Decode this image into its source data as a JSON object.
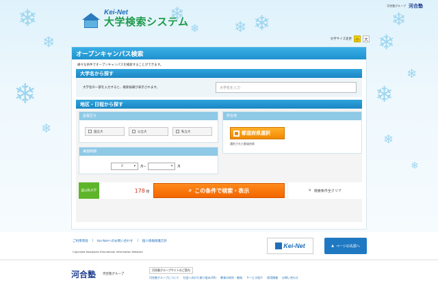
{
  "header": {
    "group_label": "河合塾グループ",
    "kawaijuku_logo": "河合塾",
    "brand_kei": "Kei-Net",
    "system_title": "大学検索システム",
    "font_size_label": "文字サイズ変更",
    "font_small": "小",
    "font_large": "大"
  },
  "page": {
    "title": "オープンキャンパス検索",
    "intro": "様々な条件でオープンキャンパスを検索することができます。"
  },
  "name_search": {
    "heading": "大学名から探す",
    "instruction": "大学名の一部を入力すると、検索候補が表示されます。",
    "placeholder": "大学名を入力",
    "value": ""
  },
  "area_search": {
    "heading": "地区・日程から探す",
    "type_heading": "設置区分",
    "types": [
      "国立大",
      "公立大",
      "私立大"
    ],
    "location_heading": "所在地",
    "pref_button": "都道府県選択",
    "selected_pref_label": "選択された都道府県",
    "period_heading": "実施時期",
    "month_from": "2",
    "month_from_suffix": "月~",
    "month_to": "",
    "month_to_suffix": "月"
  },
  "result_bar": {
    "type_tag": "国公私大学",
    "count": "178",
    "count_unit": "校",
    "search_button": "この条件で検索・表示",
    "clear_button": "検索条件全クリア"
  },
  "footer": {
    "links": [
      "ご利用環境",
      "Kei-Netへのお問い合わせ",
      "個人情報保護方針"
    ],
    "copyright": "Copyright Kawaijuku Educational Information Network",
    "banner": "Kei-Net",
    "page_top": "ページの先頭へ",
    "kawai_logo": "河合塾",
    "kawai_group": "河合塾グループ",
    "sites_title": "河合塾グループサイトのご案内",
    "sites": [
      "河合塾グループについて",
      "社会へ向けた取り組み(SR)",
      "教育の研究・開発",
      "サービス紹介",
      "採用情報",
      "お問い合わせ"
    ]
  },
  "colors": {
    "primary_blue": "#1f92cf",
    "search_orange": "#f26600",
    "pref_orange": "#f08a00",
    "tag_green": "#5fb52a",
    "count_red": "#d0301e"
  }
}
